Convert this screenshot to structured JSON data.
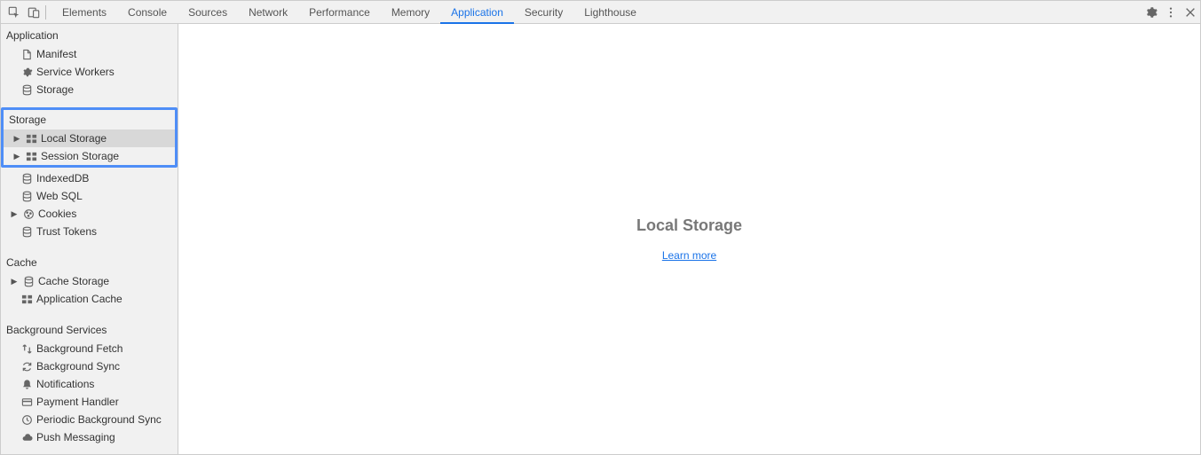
{
  "tabs": {
    "items": [
      "Elements",
      "Console",
      "Sources",
      "Network",
      "Performance",
      "Memory",
      "Application",
      "Security",
      "Lighthouse"
    ],
    "active": "Application"
  },
  "sidebar": {
    "sections": {
      "application": {
        "title": "Application",
        "items": [
          {
            "label": "Manifest"
          },
          {
            "label": "Service Workers"
          },
          {
            "label": "Storage"
          }
        ]
      },
      "storage": {
        "title": "Storage",
        "items": [
          {
            "label": "Local Storage",
            "expandable": true,
            "highlighted": true,
            "selected": true
          },
          {
            "label": "Session Storage",
            "expandable": true,
            "highlighted": true
          },
          {
            "label": "IndexedDB"
          },
          {
            "label": "Web SQL"
          },
          {
            "label": "Cookies",
            "expandable": true
          },
          {
            "label": "Trust Tokens"
          }
        ]
      },
      "cache": {
        "title": "Cache",
        "items": [
          {
            "label": "Cache Storage",
            "expandable": true
          },
          {
            "label": "Application Cache"
          }
        ]
      },
      "bg": {
        "title": "Background Services",
        "items": [
          {
            "label": "Background Fetch"
          },
          {
            "label": "Background Sync"
          },
          {
            "label": "Notifications"
          },
          {
            "label": "Payment Handler"
          },
          {
            "label": "Periodic Background Sync"
          },
          {
            "label": "Push Messaging"
          }
        ]
      }
    }
  },
  "main": {
    "title": "Local Storage",
    "learn_more": "Learn more"
  }
}
